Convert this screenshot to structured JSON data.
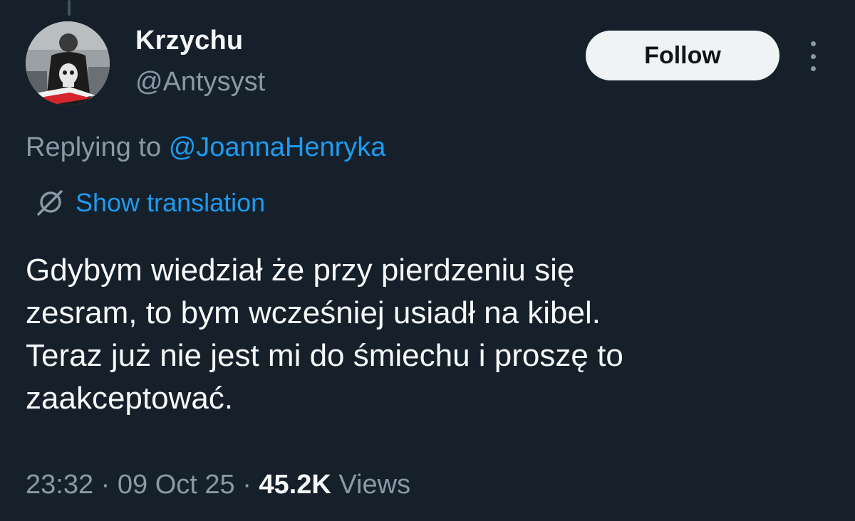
{
  "author": {
    "display_name": "Krzychu",
    "handle": "@Antysyst"
  },
  "actions": {
    "follow_label": "Follow"
  },
  "reply": {
    "prefix": "Replying to",
    "mention": "@JoannaHenryka"
  },
  "translation": {
    "label": "Show translation"
  },
  "tweet": {
    "lines": [
      "Gdybym wiedział że przy pierdzeniu się",
      "zesram, to bym wcześniej usiadł na kibel.",
      "Teraz już nie jest mi do śmiechu i proszę to",
      "zaakceptować."
    ]
  },
  "meta": {
    "time": "23:32",
    "date": "09 Oct 25",
    "separator": "·",
    "views_count": "45.2K",
    "views_label": "Views"
  },
  "colors": {
    "background": "#15202b",
    "accent": "#1d9bf0",
    "muted": "#8b98a5",
    "text": "#f7f9f9"
  },
  "icons": [
    "more-options-icon",
    "translate-icon"
  ]
}
